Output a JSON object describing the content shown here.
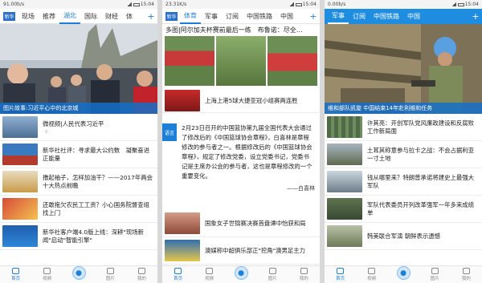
{
  "colors": {
    "accent": "#1e7fd6",
    "caption_bg": "#1a6fc4"
  },
  "panel1": {
    "status": {
      "left": "91.00b/s",
      "right": "15:04"
    },
    "logo": "新华",
    "tabs": [
      "现场",
      "推荐",
      "湖北",
      "国际",
      "财经",
      "体"
    ],
    "plus": "+",
    "hero_caption": "图片故事:习近平心中的北京城",
    "items": [
      {
        "title": "微视频|人民代表习近平",
        "meta": "· 0"
      },
      {
        "title": "新华社社评：寻求最大公约数　凝聚奋进正能量",
        "meta": ""
      },
      {
        "title": "撸起袖子，怎样加油干？——2017年两会十大热点前瞻",
        "meta": ""
      },
      {
        "title": "还敢拖欠农民工工资？小心国务院督查组找上门",
        "meta": ""
      },
      {
        "title": "新华社客户端4.0版上线：深耕\"现场新闻\"启动\"智能引擎\"",
        "meta": ""
      }
    ],
    "tabbar": [
      "首页",
      "视频",
      "",
      "图片",
      "我的"
    ]
  },
  "panel2": {
    "status": {
      "left": "23.31K/s",
      "right": "15:04"
    },
    "logo": "新华",
    "tabs": [
      "体育",
      "军事",
      "订阅",
      "中国铁路",
      "中国"
    ],
    "plus": "+",
    "headline": "多图|阿尔加夫杯赛前最后一练　布鲁诺：尽全…",
    "item1": "上海上港5球大捷亚冠小组赛两连胜",
    "quote_tag": "语言",
    "quote_text": "2月23日召开的中国篮协第九届全国代表大会通过了修改后的《中国篮球协会章程》，白喜林是章程修改的参与者之一。根据修改后的《中国篮球协会章程》，规定了修改党委，设立党委书记，党委书记是主席办公会的参与者，这也是章程修改的一个重要变化。",
    "quote_author": "——白喜林",
    "items": [
      {
        "title": "国象女子世锦赛决赛首盘谭中怡获和局",
        "meta": ""
      },
      {
        "title": "澳媒称中超俱乐部正\"挖角\"澳男足主力",
        "meta": ""
      }
    ],
    "tabbar": [
      "首页",
      "视频",
      "",
      "图片",
      "我的"
    ]
  },
  "panel3": {
    "status": {
      "left": "0.00b/s",
      "right": "15:04"
    },
    "tabs": [
      "军事",
      "订阅",
      "中国铁路",
      "中国"
    ],
    "plus": "+",
    "hero_caption": "维和部队凯旋 中国结束14年赴利维和任务",
    "items": [
      {
        "title": "许其亮：开创军队党风廉政建设和反腐败工作新局面",
        "meta": ""
      },
      {
        "title": "土耳其称意参与拉卡之战：不会占据利亚一寸土地",
        "meta": ""
      },
      {
        "title": "钱从哪里来？特朗普承诺将建史上最强大军队",
        "meta": ""
      },
      {
        "title": "军队代表委员开列改革强军一年多来成绩单",
        "meta": ""
      },
      {
        "title": "韩美联合军演 朝鲜表示遗憾",
        "meta": ""
      }
    ],
    "tabbar": [
      "首页",
      "视频",
      "",
      "图片",
      "我的"
    ]
  }
}
